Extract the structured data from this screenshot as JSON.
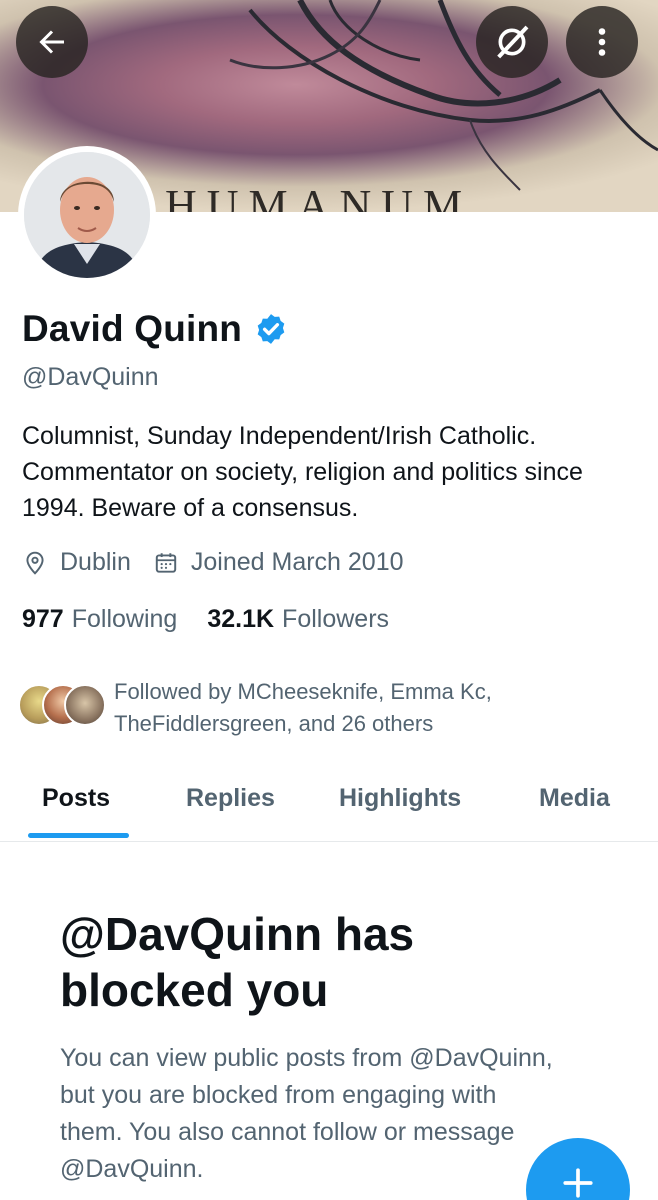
{
  "banner": {
    "text": "HUMANUM"
  },
  "header": {
    "back_icon": "arrow-left-icon",
    "grok_icon": "grok-icon",
    "more_icon": "more-vertical-icon"
  },
  "profile": {
    "name": "David Quinn",
    "verified": true,
    "handle": "@DavQuinn",
    "bio": "Columnist, Sunday Independent/Irish Catholic. Commentator on society, religion and politics since 1994. Beware of a consensus.",
    "location": "Dublin",
    "joined": "Joined March 2010",
    "following_count": "977",
    "following_label": "Following",
    "followers_count": "32.1K",
    "followers_label": "Followers",
    "followed_by": "Followed by MCheeseknife, Emma Kc, TheFiddlersgreen, and 26 others"
  },
  "tabs": [
    {
      "label": "Posts",
      "active": true
    },
    {
      "label": "Replies",
      "active": false
    },
    {
      "label": "Highlights",
      "active": false
    },
    {
      "label": "Media",
      "active": false
    }
  ],
  "blocked": {
    "title": "@DavQuinn has blocked you",
    "body": "You can view public posts from @DavQuinn, but you are blocked from engaging with them. You also cannot follow or message @DavQuinn."
  },
  "colors": {
    "accent": "#1d9bf0",
    "text": "#0f1419",
    "muted": "#536471"
  }
}
